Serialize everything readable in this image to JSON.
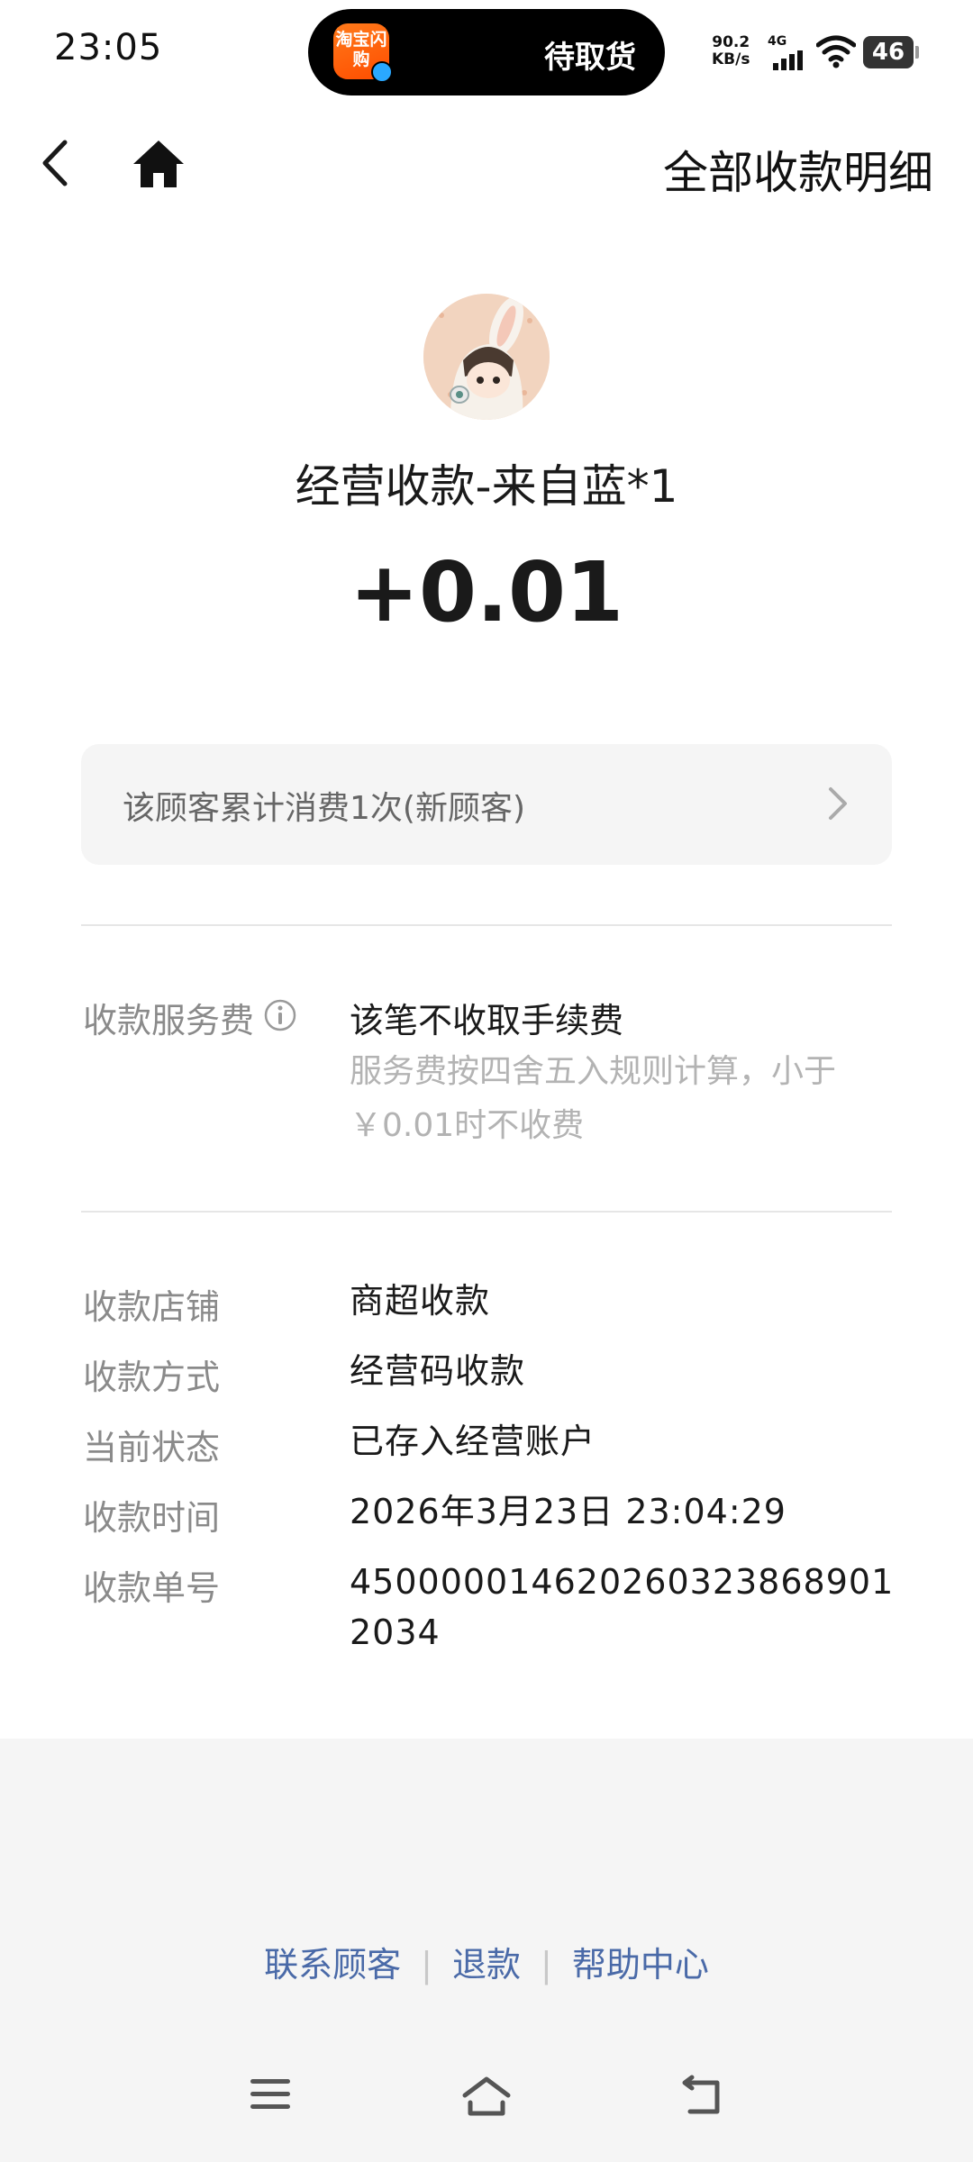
{
  "status_bar": {
    "time": "23:05",
    "island_app_label": "淘宝闪购",
    "island_text": "待取货",
    "net_speed_value": "90.2",
    "net_speed_unit": "KB/s",
    "network_type": "4G",
    "battery": "46"
  },
  "header": {
    "title": "全部收款明细",
    "back_icon": "chevron-left-icon",
    "home_icon": "home-icon"
  },
  "profile": {
    "payer": "经营收款-来自蓝*1",
    "amount": "+0.01"
  },
  "customer": {
    "summary": "该顾客累计消费1次(新顾客)"
  },
  "fee": {
    "label": "收款服务费",
    "value": "该笔不收取手续费",
    "note": "服务费按四舍五入规则计算，小于￥0.01时不收费"
  },
  "details": [
    {
      "label": "收款店铺",
      "value": "商超收款"
    },
    {
      "label": "收款方式",
      "value": "经营码收款"
    },
    {
      "label": "当前状态",
      "value": "已存入经营账户"
    },
    {
      "label": "收款时间",
      "value": "2026年3月23日 23:04:29"
    },
    {
      "label": "收款单号",
      "value": "450000014620260323868901 2034"
    }
  ],
  "footer": {
    "links": [
      "联系顾客",
      "退款",
      "帮助中心"
    ],
    "link_color": "#4a6aa8"
  }
}
